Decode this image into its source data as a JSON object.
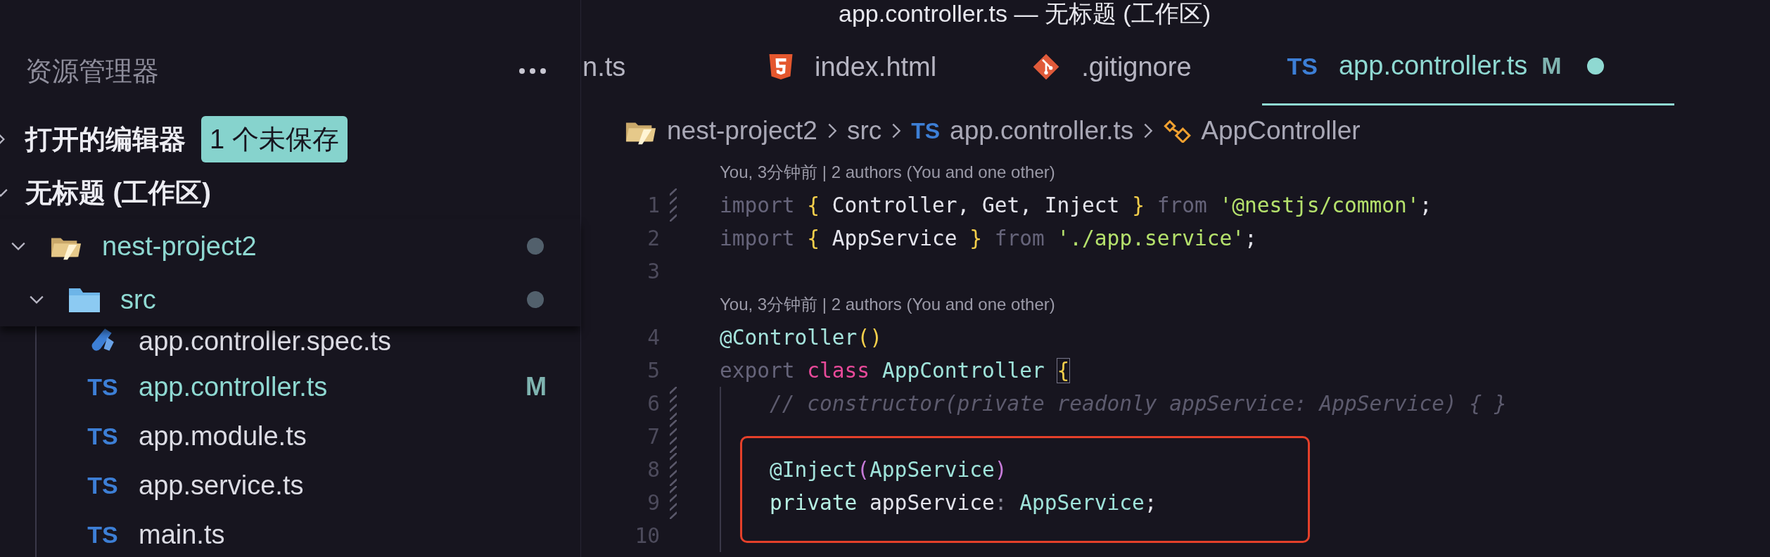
{
  "window": {
    "title": "app.controller.ts — 无标题 (工作区)"
  },
  "sidebar": {
    "title": "资源管理器",
    "sections": [
      {
        "label": "打开的编辑器",
        "expanded": false,
        "badge": "1 个未保存"
      },
      {
        "label": "无标题 (工作区)",
        "expanded": true
      }
    ],
    "tree": [
      {
        "name": "nest-project2",
        "kind": "project",
        "expanded": true,
        "dot": true,
        "children": [
          {
            "name": "src",
            "kind": "folder",
            "expanded": true,
            "dot": true,
            "children": [
              {
                "name": "app.controller.spec.ts",
                "kind": "spec"
              },
              {
                "name": "app.controller.ts",
                "kind": "ts",
                "icon_text": "TS",
                "status": "M"
              },
              {
                "name": "app.module.ts",
                "kind": "ts",
                "icon_text": "TS"
              },
              {
                "name": "app.service.ts",
                "kind": "ts",
                "icon_text": "TS"
              },
              {
                "name": "main.ts",
                "kind": "ts",
                "icon_text": "TS"
              }
            ]
          }
        ]
      }
    ]
  },
  "tabs": [
    {
      "label": "n.ts",
      "kind": "plain",
      "selected": false
    },
    {
      "label": "index.html",
      "kind": "html",
      "selected": false
    },
    {
      "label": ".gitignore",
      "kind": "git",
      "selected": false
    },
    {
      "label": "app.controller.ts",
      "kind": "ts",
      "icon_text": "TS",
      "status": "M",
      "unsaved": true,
      "selected": true
    }
  ],
  "breadcrumb": [
    {
      "label": "nest-project2",
      "kind": "project"
    },
    {
      "label": "src",
      "kind": "plain"
    },
    {
      "label": "app.controller.ts",
      "kind": "ts",
      "icon_text": "TS"
    },
    {
      "label": "AppController",
      "kind": "class"
    }
  ],
  "editor": {
    "rows": [
      {
        "kind": "lens",
        "text": "You, 3分钟前 | 2 authors (You and one other)"
      },
      {
        "kind": "code",
        "number": "1",
        "changed": true,
        "guide": false,
        "tokens": [
          {
            "t": "import ",
            "kind": "kw"
          },
          {
            "t": "{ ",
            "kind": "brace"
          },
          {
            "t": "Controller, Get, Inject ",
            "kind": "text"
          },
          {
            "t": "} ",
            "kind": "brace"
          },
          {
            "t": "from ",
            "kind": "kw"
          },
          {
            "t": "'@nestjs/common'",
            "kind": "str"
          },
          {
            "t": ";",
            "kind": "text"
          }
        ]
      },
      {
        "kind": "code",
        "number": "2",
        "changed": false,
        "guide": false,
        "tokens": [
          {
            "t": "import ",
            "kind": "kw"
          },
          {
            "t": "{ ",
            "kind": "brace"
          },
          {
            "t": "AppService ",
            "kind": "text"
          },
          {
            "t": "} ",
            "kind": "brace"
          },
          {
            "t": "from ",
            "kind": "kw"
          },
          {
            "t": "'./app.service'",
            "kind": "str"
          },
          {
            "t": ";",
            "kind": "text"
          }
        ]
      },
      {
        "kind": "code",
        "number": "3",
        "changed": false,
        "guide": false,
        "tokens": []
      },
      {
        "kind": "lens",
        "text": "You, 3分钟前 | 2 authors (You and one other)"
      },
      {
        "kind": "code",
        "number": "4",
        "changed": false,
        "guide": false,
        "tokens": [
          {
            "t": "@Controller",
            "kind": "deco"
          },
          {
            "t": "()",
            "kind": "brace"
          }
        ]
      },
      {
        "kind": "code",
        "number": "5",
        "changed": false,
        "guide": false,
        "tokens": [
          {
            "t": "export ",
            "kind": "kw"
          },
          {
            "t": "class ",
            "kind": "cls"
          },
          {
            "t": "AppController ",
            "kind": "type"
          },
          {
            "t": "{",
            "kind": "match"
          }
        ]
      },
      {
        "kind": "code",
        "number": "6",
        "changed": true,
        "guide": true,
        "tokens": [
          {
            "t": "// constructor(private readonly appService: AppService) { }",
            "kind": "comment"
          }
        ]
      },
      {
        "kind": "code",
        "number": "7",
        "changed": true,
        "guide": true,
        "tokens": []
      },
      {
        "kind": "code",
        "number": "8",
        "changed": true,
        "guide": true,
        "tokens": [
          {
            "t": "@Inject",
            "kind": "deco"
          },
          {
            "t": "(",
            "kind": "paren"
          },
          {
            "t": "AppService",
            "kind": "type"
          },
          {
            "t": ")",
            "kind": "paren"
          }
        ]
      },
      {
        "kind": "code",
        "number": "9",
        "changed": true,
        "guide": true,
        "tokens": [
          {
            "t": "private ",
            "kind": "storage"
          },
          {
            "t": "appService",
            "kind": "text"
          },
          {
            "t": ": ",
            "kind": "punct"
          },
          {
            "t": "AppService",
            "kind": "type"
          },
          {
            "t": ";",
            "kind": "text"
          }
        ]
      },
      {
        "kind": "code",
        "number": "10",
        "changed": false,
        "guide": true,
        "tokens": []
      }
    ]
  }
}
